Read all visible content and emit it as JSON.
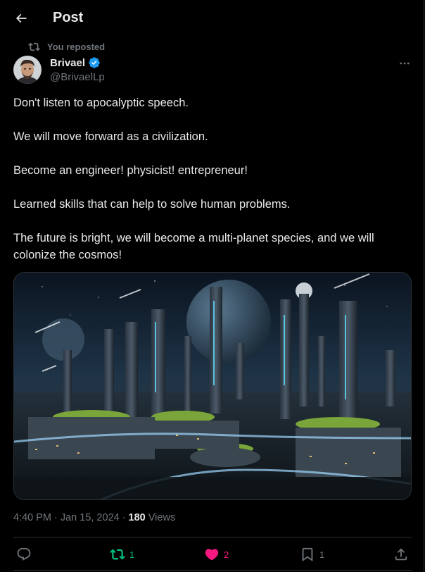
{
  "header": {
    "title": "Post"
  },
  "repost_notice": "You reposted",
  "author": {
    "display_name": "Brivael",
    "handle": "@BrivaelLp",
    "verified": true
  },
  "tweet": {
    "paragraphs": [
      "Don't listen to apocalyptic speech.",
      "We will move forward as a civilization.",
      "Become an engineer! physicist! entrepreneur!",
      "Learned skills that can help to solve human problems.",
      "The future is bright, we will become a multi-planet species, and we will colonize the cosmos!"
    ]
  },
  "meta": {
    "time": "4:40 PM",
    "separator": "·",
    "date": "Jan 15, 2024",
    "views_count": "180",
    "views_label": "Views"
  },
  "actions": {
    "reply_count": "",
    "repost_count": "1",
    "like_count": "2",
    "bookmark_count": "1"
  },
  "colors": {
    "background": "#000000",
    "text": "#e7e9ea",
    "muted": "#71767b",
    "repost_green": "#00ba7c",
    "like_pink": "#f91880",
    "verified_blue": "#1d9bf0",
    "border": "#2f3336"
  },
  "icons": [
    "back-arrow-icon",
    "repost-icon",
    "verified-badge-icon",
    "more-icon",
    "reply-icon",
    "heart-icon",
    "bookmark-icon",
    "share-icon"
  ]
}
